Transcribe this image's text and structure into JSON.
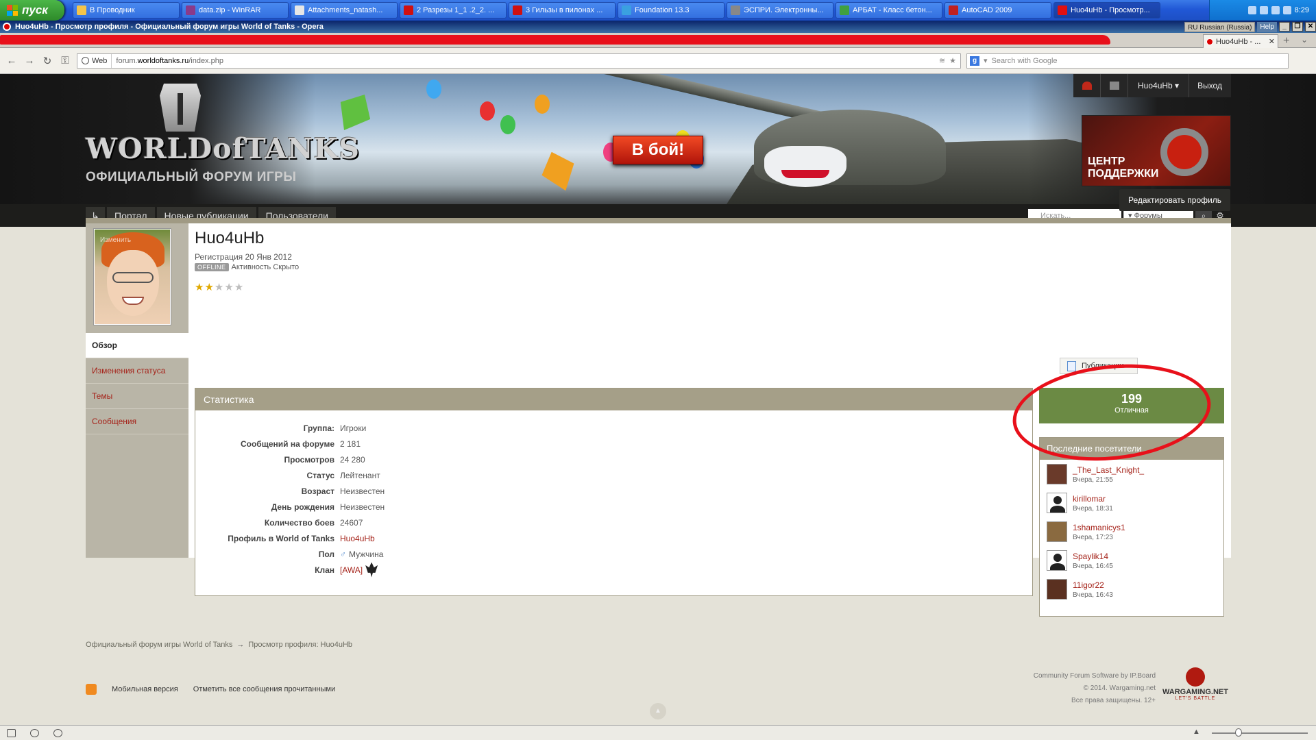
{
  "taskbar": {
    "start_label": "пуск",
    "items": [
      {
        "label": "В Проводник",
        "icon": "folder-icon",
        "color": "#f4c44a"
      },
      {
        "label": "data.zip - WinRAR",
        "icon": "winrar-icon",
        "color": "#8a3a8a"
      },
      {
        "label": "Attachments_natash...",
        "icon": "mail-icon",
        "color": "#e6e6e6"
      },
      {
        "label": "2 Разрезы 1_1 .2_2. ...",
        "icon": "pdf-icon",
        "color": "#d01010"
      },
      {
        "label": "3 Гильзы в пилонах ...",
        "icon": "pdf-icon",
        "color": "#d01010"
      },
      {
        "label": "Foundation 13.3",
        "icon": "app-icon",
        "color": "#3aa0e0"
      },
      {
        "label": "ЭСПРИ. Электронны...",
        "icon": "app-icon",
        "color": "#888888"
      },
      {
        "label": "АРБАТ - Класс бетон...",
        "icon": "app-icon",
        "color": "#40a040"
      },
      {
        "label": "AutoCAD 2009",
        "icon": "autocad-icon",
        "color": "#c02020"
      },
      {
        "label": "Huo4uHb - Просмотр...",
        "icon": "opera-icon",
        "color": "#e01010",
        "active": true
      }
    ],
    "clock": "8:29"
  },
  "window": {
    "title": "Huo4uHb - Просмотр профиля - Официальный форум игры World of Tanks - Opera",
    "language": "RU Russian (Russia)",
    "help": "Help"
  },
  "browser": {
    "current_tab": "Huo4uHb - ...",
    "web_label": "Web",
    "url_prefix": "forum.",
    "url_domain": "worldoftanks.ru",
    "url_path": "/index.php",
    "search_placeholder": "Search with Google"
  },
  "banner": {
    "logo_text": "WORLDofTANKS",
    "subtitle": "ОФИЦИАЛЬНЫЙ ФОРУМ ИГРЫ",
    "fight_button": "В бой!",
    "username": "Huo4uHb",
    "logout": "Выход",
    "support_line1": "ЦЕНТР",
    "support_line2": "ПОДДЕРЖКИ"
  },
  "nav": {
    "items": [
      "Портал",
      "Новые публикации",
      "Пользователи"
    ],
    "search_placeholder": "Искать...",
    "search_scope": "Форумы"
  },
  "breadcrumb": {
    "root": "Официальный форум игры World of Tanks",
    "current": "Просмотр профиля: Huo4uHb"
  },
  "profile": {
    "edit_button": "Редактировать профиль",
    "avatar_label": "Изменить",
    "name": "Huo4uHb",
    "registered": "Регистрация 20 Янв 2012",
    "offline_badge": "OFFLINE",
    "activity": "Активность Скрыто",
    "stars": {
      "filled": 2,
      "total": 5
    },
    "menu": [
      "Обзор",
      "Изменения статуса",
      "Темы",
      "Сообщения"
    ],
    "publications_button": "Публикации"
  },
  "stats": {
    "title": "Статистика",
    "rows": [
      {
        "label": "Группа:",
        "value": "Игроки"
      },
      {
        "label": "Сообщений на форуме",
        "value": "2 181"
      },
      {
        "label": "Просмотров",
        "value": "24 280"
      },
      {
        "label": "Статус",
        "value": "Лейтенант"
      },
      {
        "label": "Возраст",
        "value": "Неизвестен"
      },
      {
        "label": "День рождения",
        "value": "Неизвестен"
      },
      {
        "label": "Количество боев",
        "value": "24607"
      },
      {
        "label": "Профиль в World of Tanks",
        "value": "Huo4uHb",
        "link": true
      },
      {
        "label": "Пол",
        "value": "Мужчина",
        "icon": "gender-male-icon"
      },
      {
        "label": "Клан",
        "value": "[AWA]",
        "link": true,
        "icon": "clan-emblem-icon"
      }
    ]
  },
  "reputation": {
    "value": "199",
    "label": "Отличная"
  },
  "visitors": {
    "title": "Последние посетители",
    "items": [
      {
        "name": "_The_Last_Knight_",
        "time": "Вчера, 21:55",
        "avatar": "photo"
      },
      {
        "name": "kirillomar",
        "time": "Вчера, 18:31",
        "avatar": "generic"
      },
      {
        "name": "1shamanicys1",
        "time": "Вчера, 17:23",
        "avatar": "photo"
      },
      {
        "name": "Spaylik14",
        "time": "Вчера, 16:45",
        "avatar": "generic"
      },
      {
        "name": "11igor22",
        "time": "Вчера, 16:43",
        "avatar": "photo"
      }
    ]
  },
  "footer": {
    "mobile": "Мобильная версия",
    "mark_read": "Отметить все сообщения прочитанными",
    "software": "Community Forum Software by IP.Board",
    "copyright": "© 2014. Wargaming.net",
    "rights": "Все права защищены. 12+",
    "brand": "WARGAMING.NET",
    "brand_sub": "LET'S BATTLE"
  },
  "colors": {
    "accent_red": "#a5231a",
    "panel_header": "#a59f88",
    "reputation_green": "#6b8a44",
    "annotation_red": "#e8101a"
  }
}
